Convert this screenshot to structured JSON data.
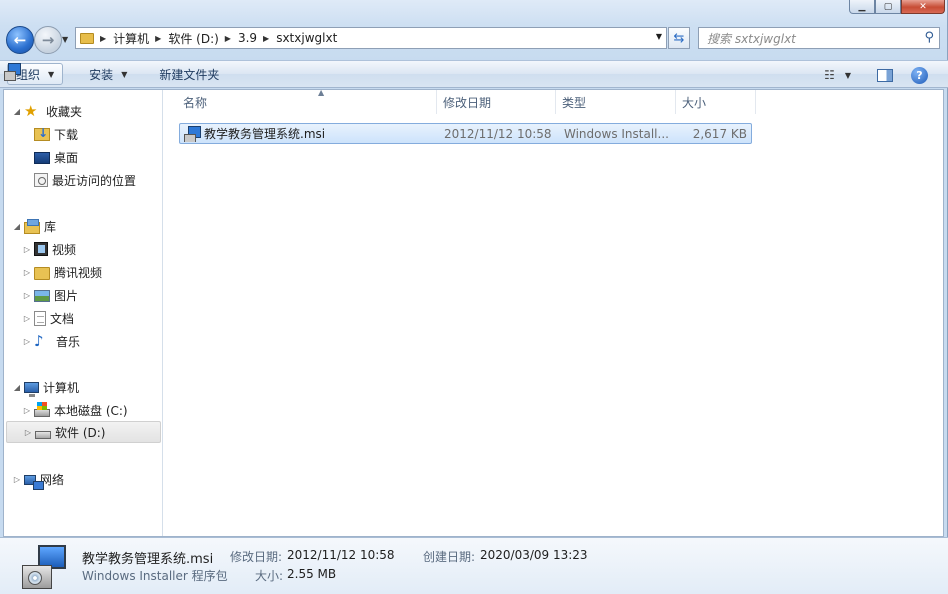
{
  "window": {
    "caption": {
      "minimize": "▁",
      "maximize": "▢",
      "close": "✕"
    }
  },
  "nav": {
    "breadcrumbs": [
      "计算机",
      "软件 (D:)",
      "3.9",
      "sxtxjwglxt"
    ],
    "search_placeholder": "搜索 sxtxjwglxt"
  },
  "toolbar": {
    "organize": "组织",
    "install": "安装",
    "new_folder": "新建文件夹"
  },
  "sidebar": {
    "favorites": {
      "label": "收藏夹",
      "items": [
        "下载",
        "桌面",
        "最近访问的位置"
      ]
    },
    "libraries": {
      "label": "库",
      "items": [
        "视频",
        "腾讯视频",
        "图片",
        "文档",
        "音乐"
      ]
    },
    "computer": {
      "label": "计算机",
      "items": [
        "本地磁盘 (C:)",
        "软件 (D:)"
      ]
    },
    "network": {
      "label": "网络"
    }
  },
  "columns": [
    "名称",
    "修改日期",
    "类型",
    "大小"
  ],
  "files": [
    {
      "name": "教学教务管理系统.msi",
      "modified": "2012/11/12 10:58",
      "type": "Windows Install...",
      "size": "2,617 KB"
    }
  ],
  "details": {
    "name": "教学教务管理系统.msi",
    "type": "Windows Installer 程序包",
    "modified_label": "修改日期:",
    "modified": "2012/11/12 10:58",
    "size_label": "大小:",
    "size": "2.55 MB",
    "created_label": "创建日期:",
    "created": "2020/03/09 13:23"
  }
}
